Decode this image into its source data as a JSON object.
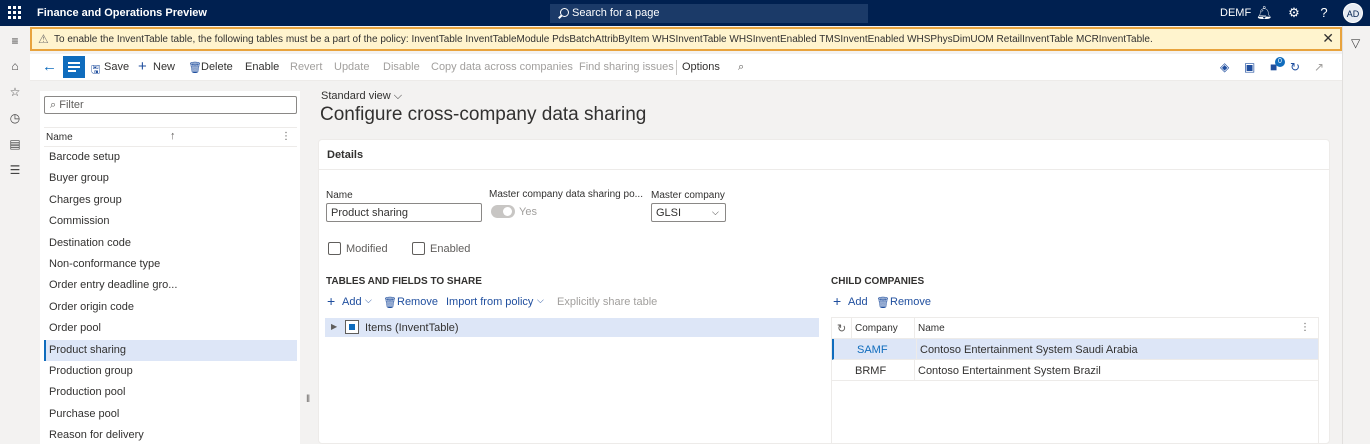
{
  "topbar": {
    "title": "Finance and Operations Preview",
    "search_placeholder": "Search for a page",
    "company": "DEMF",
    "avatar_initials": "AD"
  },
  "warning": {
    "text": "To enable the InventTable table, the following tables must be a part of the policy: InventTable InventTableModule PdsBatchAttribByItem WHSInventTable WHSInventEnabled TMSInventEnabled WHSPhysDimUOM RetailInventTable MCRInventTable."
  },
  "actionpane": {
    "save": "Save",
    "new": "New",
    "delete": "Delete",
    "enable": "Enable",
    "revert": "Revert",
    "update": "Update",
    "disable": "Disable",
    "copy": "Copy data across companies",
    "find": "Find sharing issues",
    "options": "Options",
    "notification_count": "0"
  },
  "list": {
    "filter_placeholder": "Filter",
    "column": "Name",
    "items": [
      "Barcode setup",
      "Buyer group",
      "Charges group",
      "Commission",
      "Destination code",
      "Non-conformance type",
      "Order entry deadline gro...",
      "Order origin code",
      "Order pool",
      "Product sharing",
      "Production group",
      "Production pool",
      "Purchase pool",
      "Reason for delivery"
    ],
    "selected_index": 9
  },
  "main": {
    "view_label": "Standard view",
    "title": "Configure cross-company data sharing",
    "details_header": "Details",
    "name_label": "Name",
    "name_value": "Product sharing",
    "master_policy_label": "Master company data sharing po...",
    "master_policy_value": "Yes",
    "master_company_label": "Master company",
    "master_company_value": "GLSI",
    "modified_label": "Modified",
    "enabled_label": "Enabled",
    "tables_header": "TABLES AND FIELDS TO SHARE",
    "tables_add": "Add",
    "tables_remove": "Remove",
    "tables_import": "Import from policy",
    "tables_explicit": "Explicitly share table",
    "tree_item": "Items (InventTable)",
    "child_header": "CHILD COMPANIES",
    "child_add": "Add",
    "child_remove": "Remove",
    "grid_col_company": "Company",
    "grid_col_name": "Name",
    "grid_rows": [
      {
        "company": "SAMF",
        "name": "Contoso Entertainment System Saudi Arabia"
      },
      {
        "company": "BRMF",
        "name": "Contoso Entertainment System Brazil"
      }
    ]
  }
}
